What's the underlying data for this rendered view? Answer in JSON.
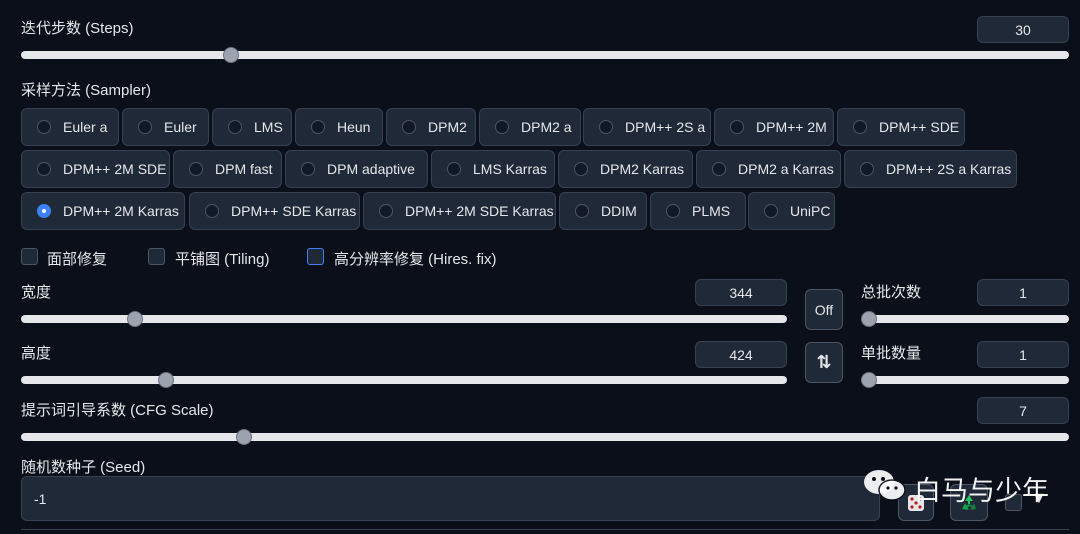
{
  "steps": {
    "label": "迭代步数 (Steps)",
    "value": "30",
    "fraction": 0.14
  },
  "sampler": {
    "label": "采样方法 (Sampler)",
    "options": [
      "Euler a",
      "Euler",
      "LMS",
      "Heun",
      "DPM2",
      "DPM2 a",
      "DPM++ 2S a",
      "DPM++ 2M",
      "DPM++ SDE",
      "DPM++ 2M SDE",
      "DPM fast",
      "DPM adaptive",
      "LMS Karras",
      "DPM2 Karras",
      "DPM2 a Karras",
      "DPM++ 2S a Karras",
      "DPM++ 2M Karras",
      "DPM++ SDE Karras",
      "DPM++ 2M SDE Karras",
      "DDIM",
      "PLMS",
      "UniPC"
    ],
    "selected": "DPM++ 2M Karras"
  },
  "checkboxes": {
    "face_restore": "面部修复",
    "tiling": "平铺图 (Tiling)",
    "hires_fix": "高分辨率修复 (Hires. fix)"
  },
  "width": {
    "label": "宽度",
    "value": "344",
    "fraction": 0.15
  },
  "height": {
    "label": "高度",
    "value": "424",
    "fraction": 0.19
  },
  "batch_count": {
    "label": "总批次数",
    "value": "1",
    "fraction": 0.0
  },
  "batch_size": {
    "label": "单批数量",
    "value": "1",
    "fraction": 0.0
  },
  "toggle_off_label": "Off",
  "swap_label": "⇅",
  "cfg": {
    "label": "提示词引导系数 (CFG Scale)",
    "value": "7",
    "fraction": 0.2
  },
  "seed": {
    "label": "随机数种子 (Seed)",
    "value": "-1"
  },
  "watermark": "白马与少年",
  "icons": {
    "dice": "dice-icon",
    "recycle": "recycle-icon",
    "wechat": "wechat-logo-icon"
  },
  "colors": {
    "accent": "#3b82f6",
    "background": "#0b0f19",
    "panel": "#1f2937"
  }
}
